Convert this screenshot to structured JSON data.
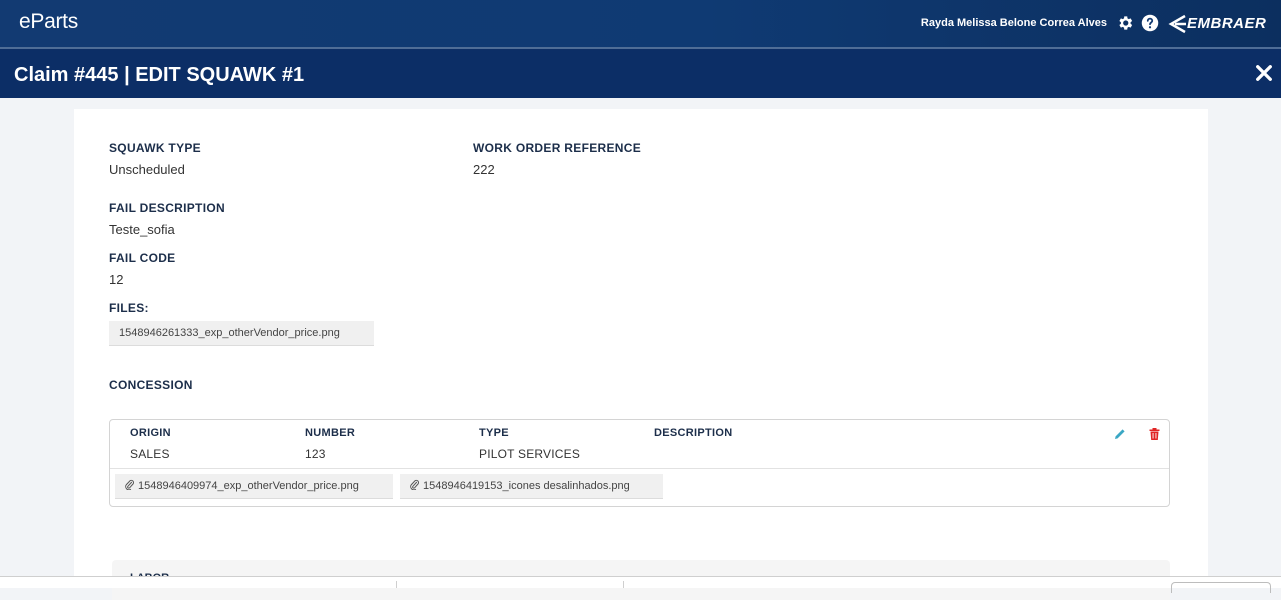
{
  "app": {
    "brand": "eParts",
    "user_name": "Rayda Melissa Belone Correa Alves",
    "logo_text": "EMBRAER"
  },
  "header": {
    "title": "Claim #445 | EDIT SQUAWK #1"
  },
  "squawk": {
    "squawk_type_label": "SQUAWK TYPE",
    "squawk_type_value": "Unscheduled",
    "work_order_label": "WORK ORDER REFERENCE",
    "work_order_value": "222",
    "fail_description_label": "FAIL DESCRIPTION",
    "fail_description_value": "Teste_sofia",
    "fail_code_label": "FAIL CODE",
    "fail_code_value": "12",
    "files_label": "FILES:",
    "files": [
      "1548946261333_exp_otherVendor_price.png"
    ]
  },
  "concession": {
    "label": "CONCESSION",
    "columns": [
      "ORIGIN",
      "NUMBER",
      "TYPE",
      "DESCRIPTION"
    ],
    "row": {
      "origin": "SALES",
      "number": "123",
      "type": "PILOT SERVICES",
      "description": ""
    },
    "files": [
      "1548946409974_exp_otherVendor_price.png",
      "1548946419153_icones desalinhados.png"
    ]
  },
  "labor": {
    "label": "LABOR"
  },
  "colors": {
    "topbar": "#123a72",
    "titlebar": "#0c2e66",
    "edit_icon": "#3aa7c4",
    "delete_icon": "#e02424"
  },
  "icons": [
    "gear-icon",
    "help-icon",
    "embraer-logo-icon",
    "close-icon",
    "paperclip-icon",
    "edit-icon",
    "trash-icon"
  ]
}
